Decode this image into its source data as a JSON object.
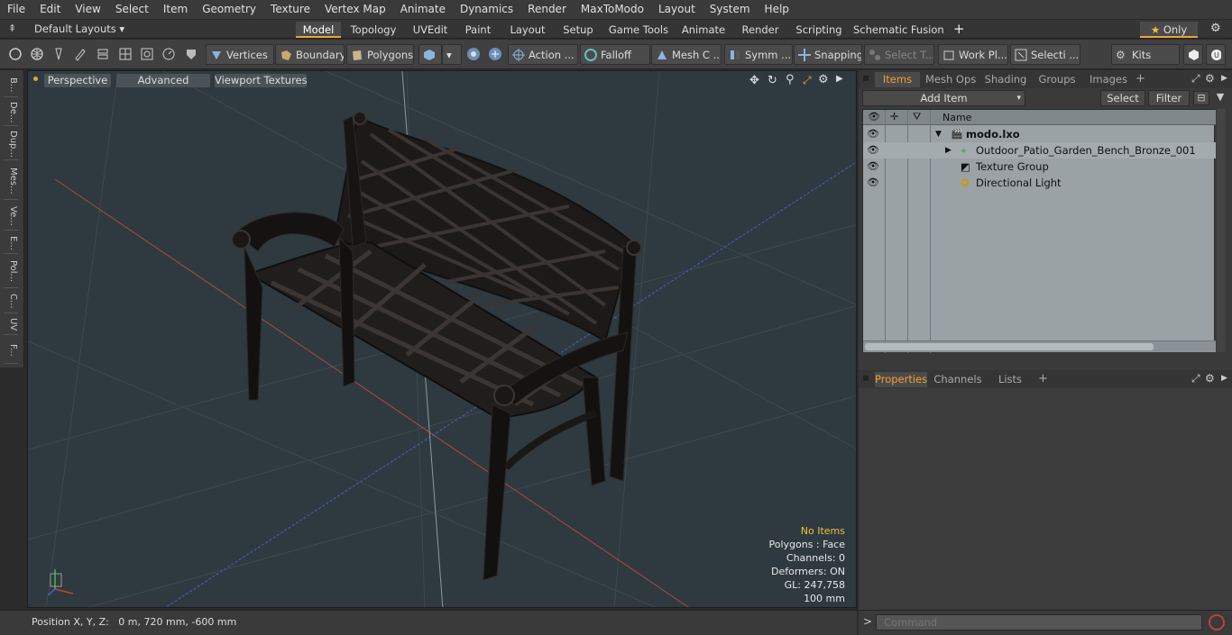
{
  "menu": [
    "File",
    "Edit",
    "View",
    "Select",
    "Item",
    "Geometry",
    "Texture",
    "Vertex Map",
    "Animate",
    "Dynamics",
    "Render",
    "MaxToModo",
    "Layout",
    "System",
    "Help"
  ],
  "layout": {
    "dropdown": "Default Layouts",
    "tabs": [
      "Model",
      "Topology",
      "UVEdit",
      "Paint",
      "Layout",
      "Setup",
      "Game Tools",
      "Animate",
      "Render",
      "Scripting",
      "Schematic Fusion"
    ],
    "active_tab": "Model",
    "only_label": "Only"
  },
  "toolbar": {
    "vertices": "Vertices",
    "boundary": "Boundary",
    "polygons": "Polygons",
    "action": "Action ...",
    "falloff": "Falloff",
    "mesh": "Mesh C ...",
    "symm": "Symm ...",
    "snapping": "Snapping",
    "select_t": "Select T...",
    "work_pl": "Work Pl...",
    "selecti": "Selecti ...",
    "kits": "Kits"
  },
  "left_tabs": [
    "B...",
    "De...",
    "Dup...",
    "Mes...",
    "Ve...",
    "E...",
    "Pol...",
    "C...",
    "UV",
    "F..."
  ],
  "viewport": {
    "perspective": "Perspective",
    "advanced": "Advanced",
    "textures": "Viewport Textures",
    "stats": {
      "no_items": "No Items",
      "polygons": "Polygons : Face",
      "channels": "Channels: 0",
      "deformers": "Deformers: ON",
      "gl": "GL: 247,758",
      "size": "100 mm"
    }
  },
  "status": {
    "position": "Position X, Y, Z:   0 m, 720 mm, -600 mm"
  },
  "items_panel": {
    "tabs": [
      "Items",
      "Mesh Ops",
      "Shading",
      "Groups",
      "Images"
    ],
    "add_item": "Add Item",
    "select": "Select",
    "filter": "Filter",
    "column_name": "Name",
    "tree": [
      {
        "label": "modo.lxo",
        "bold": true
      },
      {
        "label": "Outdoor_Patio_Garden_Bench_Bronze_001"
      },
      {
        "label": "Texture Group"
      },
      {
        "label": "Directional Light"
      }
    ]
  },
  "properties_panel": {
    "tabs": [
      "Properties",
      "Channels",
      "Lists"
    ]
  },
  "command": {
    "placeholder": "Command"
  },
  "colors": {
    "accent": "#e8a53a",
    "viewport_bg": "#2e3a3f",
    "list_bg": "#9aa2a6"
  }
}
